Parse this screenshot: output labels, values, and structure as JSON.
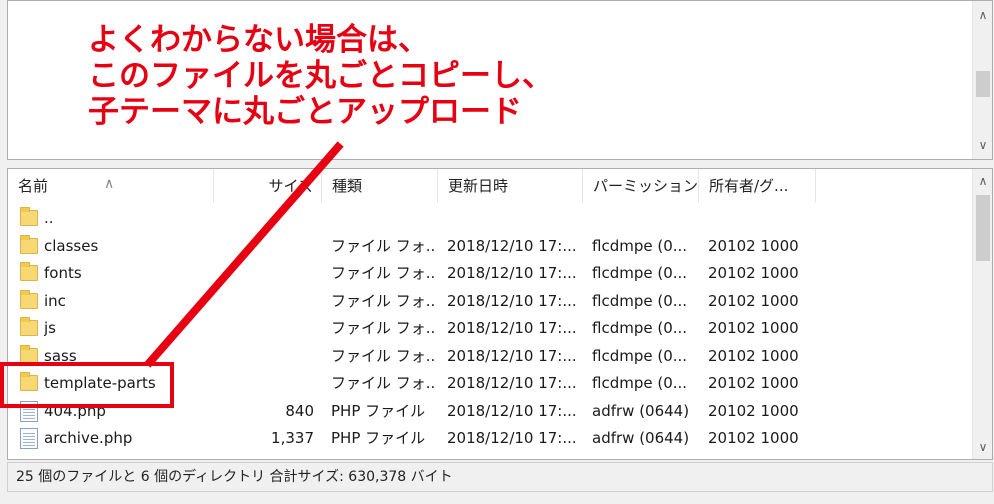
{
  "annotation": {
    "line1": "よくわからない場合は、",
    "line2": "このファイルを丸ごとコピーし、",
    "line3": "子テーマに丸ごとアップロード",
    "color": "#e60012"
  },
  "columns": {
    "name": "名前",
    "size": "サイズ",
    "type": "種類",
    "modified": "更新日時",
    "permission": "パーミッション",
    "owner": "所有者/グ..."
  },
  "rows": [
    {
      "icon": "folder-icon",
      "name": "..",
      "size": "",
      "type": "",
      "modified": "",
      "permission": "",
      "owner": ""
    },
    {
      "icon": "folder-icon",
      "name": "classes",
      "size": "",
      "type": "ファイル フォ...",
      "modified": "2018/12/10 17:...",
      "permission": "flcdmpe (0...",
      "owner": "20102 1000"
    },
    {
      "icon": "folder-icon",
      "name": "fonts",
      "size": "",
      "type": "ファイル フォ...",
      "modified": "2018/12/10 17:...",
      "permission": "flcdmpe (0...",
      "owner": "20102 1000"
    },
    {
      "icon": "folder-icon",
      "name": "inc",
      "size": "",
      "type": "ファイル フォ...",
      "modified": "2018/12/10 17:...",
      "permission": "flcdmpe (0...",
      "owner": "20102 1000"
    },
    {
      "icon": "folder-icon",
      "name": "js",
      "size": "",
      "type": "ファイル フォ...",
      "modified": "2018/12/10 17:...",
      "permission": "flcdmpe (0...",
      "owner": "20102 1000"
    },
    {
      "icon": "folder-icon",
      "name": "sass",
      "size": "",
      "type": "ファイル フォ...",
      "modified": "2018/12/10 17:...",
      "permission": "flcdmpe (0...",
      "owner": "20102 1000"
    },
    {
      "icon": "folder-icon",
      "name": "template-parts",
      "size": "",
      "type": "ファイル フォ...",
      "modified": "2018/12/10 17:...",
      "permission": "flcdmpe (0...",
      "owner": "20102 1000"
    },
    {
      "icon": "php-file-icon",
      "name": "404.php",
      "size": "840",
      "type": "PHP ファイル",
      "modified": "2018/12/10 17:...",
      "permission": "adfrw (0644)",
      "owner": "20102 1000"
    },
    {
      "icon": "php-file-icon",
      "name": "archive.php",
      "size": "1,337",
      "type": "PHP ファイル",
      "modified": "2018/12/10 17:...",
      "permission": "adfrw (0644)",
      "owner": "20102 1000"
    }
  ],
  "status": "25 個のファイルと 6 個のディレクトリ 合計サイズ: 630,378 バイト"
}
